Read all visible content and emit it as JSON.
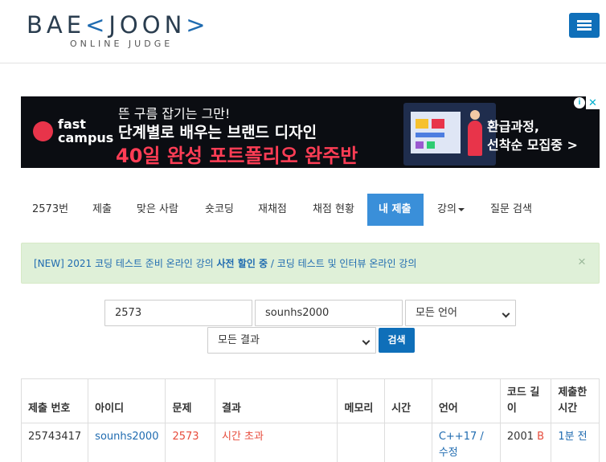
{
  "header": {
    "logo_prefix": "BAE",
    "logo_bracket_left": "<",
    "logo_mid": "JOON",
    "logo_bracket_right": ">",
    "logo_sub": "ONLINE JUDGE"
  },
  "ad": {
    "brand": "fast campus",
    "brand_line1": "fast",
    "brand_line2": "campus",
    "line1": "뜬 구름 잡기는 그만!",
    "line2": "단계별로 배우는 브랜드 디자인",
    "line3": "40일 완성 포트폴리오 완주반",
    "right1": "환급과정,",
    "right2": "선착순 모집중 >",
    "info_icon": "i",
    "close_icon": "✕"
  },
  "tabs": [
    {
      "label": "2573번"
    },
    {
      "label": "제출"
    },
    {
      "label": "맞은 사람"
    },
    {
      "label": "숏코딩"
    },
    {
      "label": "재채점"
    },
    {
      "label": "채점 현황"
    },
    {
      "label": "내 제출"
    },
    {
      "label": "강의"
    },
    {
      "label": "질문 검색"
    }
  ],
  "alert": {
    "prefix": "[NEW] 2021 코딩 테스트 준비 온라인 강의 ",
    "bold": "사전 할인 중",
    "suffix": " / 코딩 테스트 및 인터뷰 온라인 강의",
    "close": "×"
  },
  "filters": {
    "problem_id": "2573",
    "user_id": "sounhs2000",
    "language": "모든 언어",
    "result": "모든 결과",
    "search_label": "검색"
  },
  "table": {
    "headers": [
      "제출 번호",
      "아이디",
      "문제",
      "결과",
      "메모리",
      "시간",
      "언어",
      "코드 길이",
      "제출한 시간"
    ],
    "rows": [
      {
        "submission_id": "25743417",
        "user": "sounhs2000",
        "problem": "2573",
        "result": "시간 초과",
        "memory": "",
        "time": "",
        "language": "C++17",
        "edit": "수정",
        "separator": " / ",
        "code_length": "2001",
        "code_unit": "B",
        "submitted": "1분 전"
      }
    ]
  },
  "colors": {
    "brand_blue": "#0f6fb9",
    "active_tab": "#3a8fd9",
    "link_blue": "#1f6bb0",
    "error_red": "#e74c3c",
    "alert_bg": "#dff0d8"
  }
}
